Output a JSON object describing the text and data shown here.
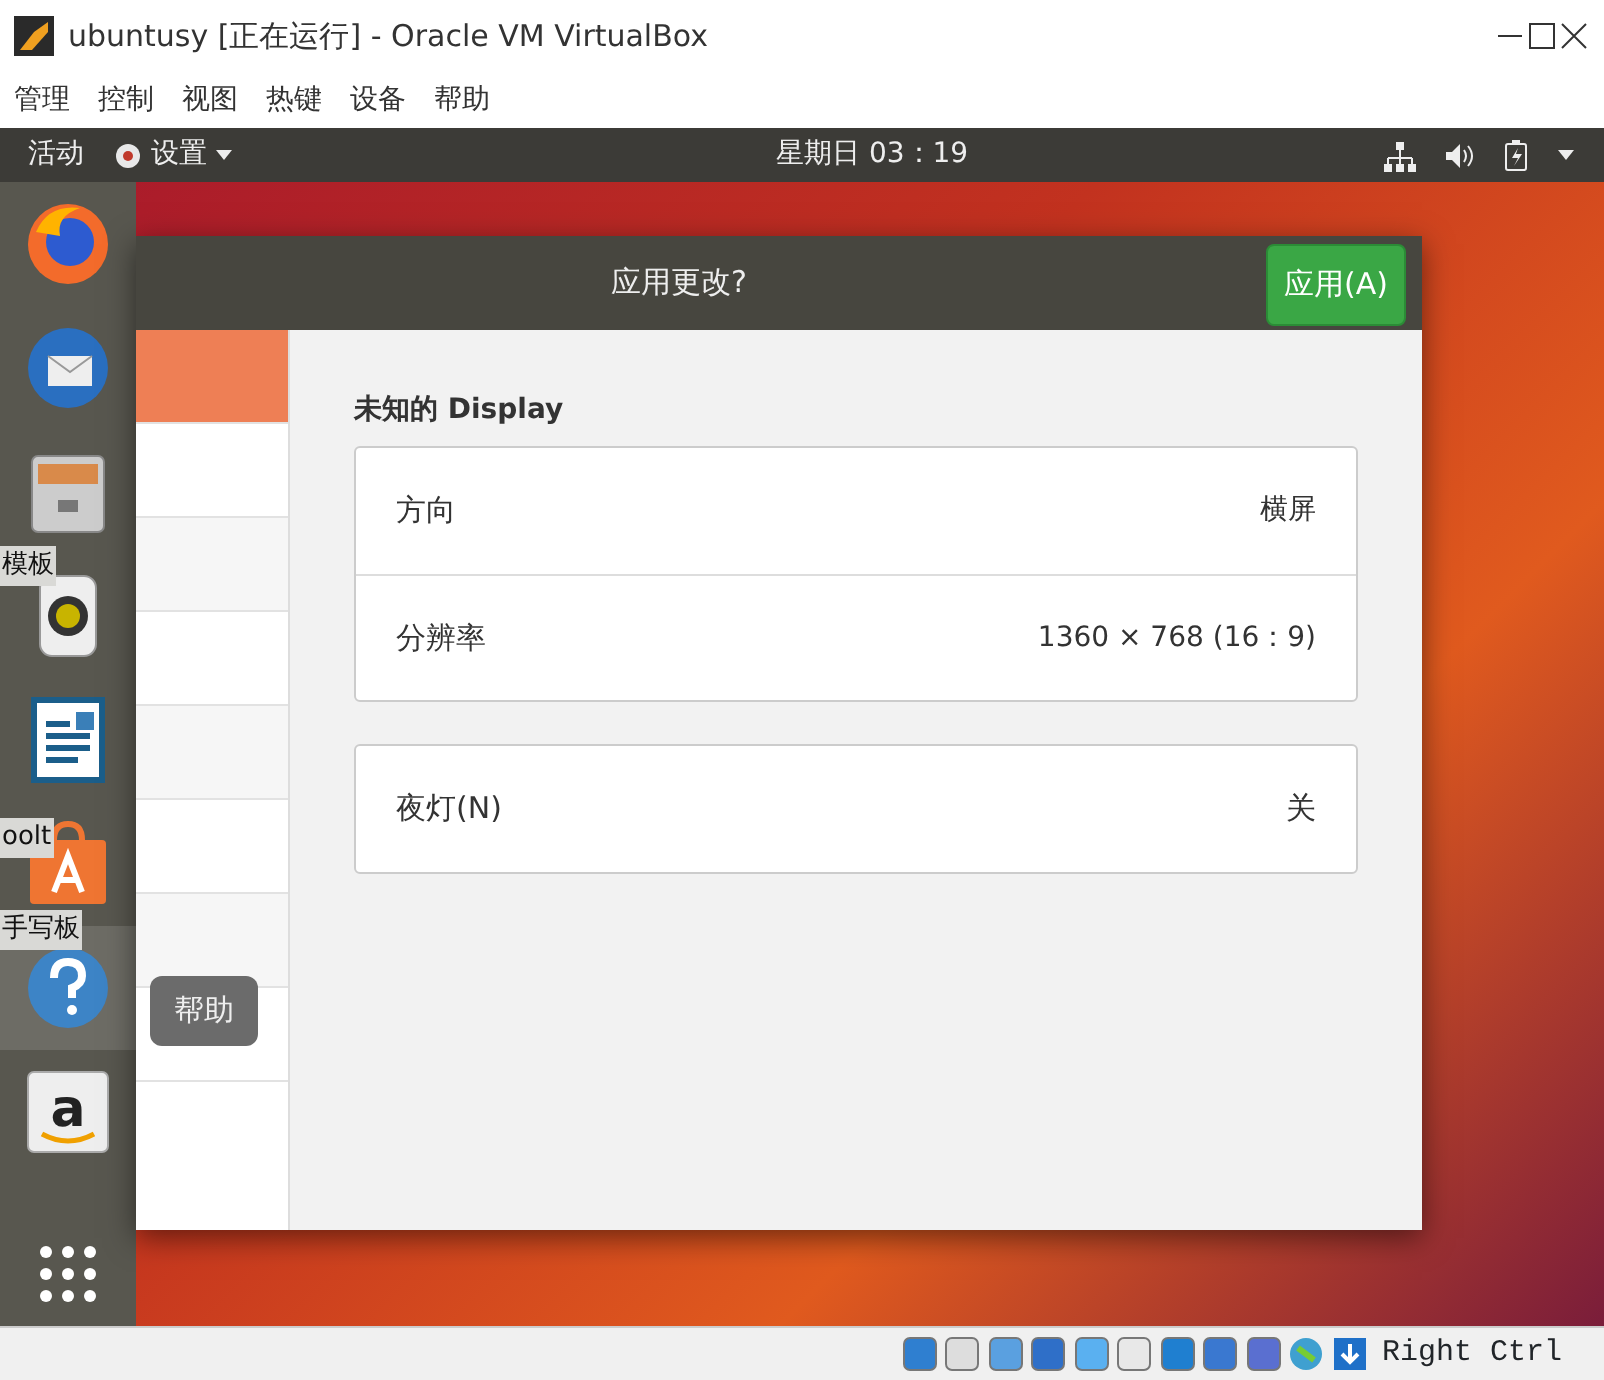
{
  "window": {
    "title": "ubuntusy [正在运行] - Oracle VM VirtualBox"
  },
  "menu": [
    "管理",
    "控制",
    "视图",
    "热键",
    "设备",
    "帮助"
  ],
  "top_bar": {
    "activities": "活动",
    "app_menu": "设置",
    "clock": "星期日 03：19"
  },
  "dock": [
    {
      "kind": "firefox",
      "selected": false
    },
    {
      "kind": "thunderbird",
      "selected": false
    },
    {
      "kind": "files",
      "selected": false
    },
    {
      "kind": "rhythmbox",
      "selected": false
    },
    {
      "kind": "writer",
      "selected": false
    },
    {
      "kind": "software",
      "selected": false
    },
    {
      "kind": "help",
      "selected": true
    },
    {
      "kind": "amazon",
      "selected": false
    }
  ],
  "background_texts": [
    {
      "text": "模板",
      "kind": "a"
    },
    {
      "text": "oolt",
      "kind": "b"
    },
    {
      "text": "手写板",
      "kind": "c"
    }
  ],
  "tooltip": "帮助",
  "dialog": {
    "title": "应用更改?",
    "apply_button": "应用(A)"
  },
  "sidebar": {
    "items": [
      {
        "selected": true
      },
      {
        "selected": false
      },
      {
        "selected": false
      },
      {
        "selected": false
      },
      {
        "selected": false
      },
      {
        "selected": false
      },
      {
        "selected": false
      },
      {
        "selected": false
      }
    ]
  },
  "display": {
    "heading": "未知的 Display",
    "rows": [
      {
        "label": "方向",
        "value": "横屏"
      },
      {
        "label": "分辨率",
        "value": "1360 × 768 (16：9)"
      }
    ],
    "night_light": {
      "label": "夜灯(N)",
      "value": "关"
    }
  },
  "status_bar": {
    "host_key": "Right Ctrl"
  }
}
